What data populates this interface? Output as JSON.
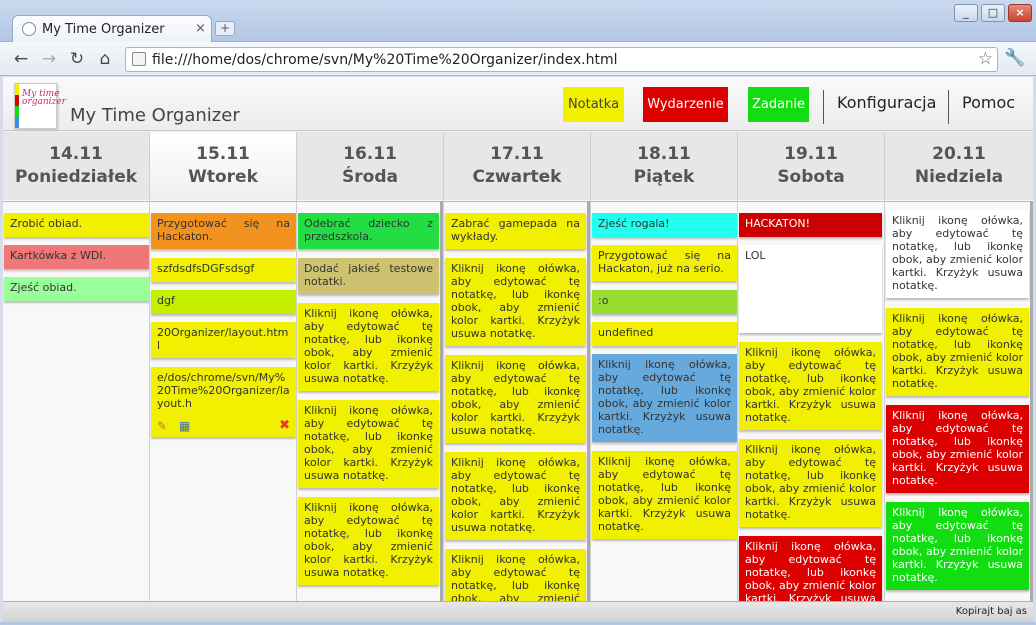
{
  "browser": {
    "tab_title": "My Time Organizer",
    "tab_close": "×",
    "new_tab": "+",
    "url": "file:///home/dos/chrome/svn/My%20Time%20Organizer/index.html",
    "icons": {
      "back": "←",
      "forward": "→",
      "reload": "↻",
      "home": "⌂",
      "star": "☆",
      "wrench": "🔧",
      "minimize": "_",
      "maximize": "□",
      "close": "×"
    }
  },
  "app": {
    "logo_text": "My time organizer",
    "title": "My Time Organizer",
    "buttons": {
      "note": "Notatka",
      "event": "Wydarzenie",
      "task": "Zadanie"
    },
    "links": {
      "config": "Konfiguracja",
      "help": "Pomoc"
    },
    "colors": {
      "yellow": "#f1f000",
      "red": "#dd0000",
      "green": "#11dd11"
    }
  },
  "days": [
    {
      "date": "14.11",
      "name": "Poniedziałek"
    },
    {
      "date": "15.11",
      "name": "Wtorek"
    },
    {
      "date": "16.11",
      "name": "Środa"
    },
    {
      "date": "17.11",
      "name": "Czwartek"
    },
    {
      "date": "18.11",
      "name": "Piątek"
    },
    {
      "date": "19.11",
      "name": "Sobota"
    },
    {
      "date": "20.11",
      "name": "Niedziela"
    }
  ],
  "notes": {
    "d0": [
      "Zrobić obiad.",
      "Kartkówka z WDI.",
      "Zjeść obiad."
    ],
    "d1": [
      "Przygotować się na Hackaton.",
      "szfdsdfsDGFsdsgf",
      "dgf",
      "20Organizer/layout.html",
      "e/dos/chrome/svn/My%20Time%20Organizer/layout.h"
    ],
    "d2": [
      "Odebrać dziecko z przedszkola.",
      "Dodać jakieś testowe notatki."
    ],
    "d3": [
      "Zabrać gamepada na wykłady."
    ],
    "d4": [
      "Zjeść rogala!",
      "Przygotować się na Hackaton, już na serio.",
      ":o",
      "undefined"
    ],
    "d5": [
      "HACKATON!",
      "LOL"
    ],
    "default_text": "Kliknij ikonę ołówka, aby edytować tę notatkę, lub ikonkę obok, aby zmienić kolor kartki. Krzyżyk usuwa notatkę."
  },
  "status": "Kopirajt baj as"
}
